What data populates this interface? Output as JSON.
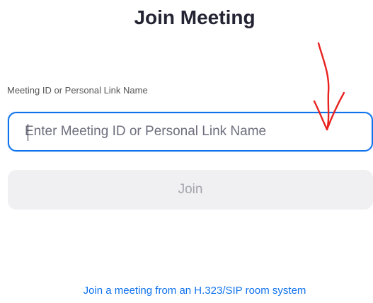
{
  "window": {
    "title": "Join Meeting"
  },
  "form": {
    "field_label": "Meeting ID or Personal Link Name",
    "input_placeholder": "Enter Meeting ID or Personal Link Name",
    "input_value": "",
    "join_label": "Join"
  },
  "footer": {
    "sip_link": "Join a meeting from an H.323/SIP room system"
  },
  "colors": {
    "accent": "#0e72ed",
    "annotation": "#e8231f",
    "disabled_button_bg": "#f0f0f2"
  },
  "icons": {
    "annotation": "arrow-down-icon"
  }
}
